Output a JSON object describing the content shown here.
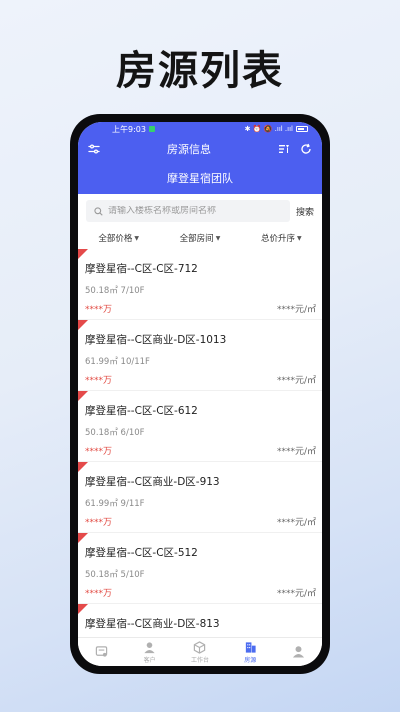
{
  "hero_title": "房源列表",
  "status_bar": {
    "time": "上午9:03",
    "icons_text": "✱ ⏰ 🔕 .ııl .ııl",
    "battery": ""
  },
  "header": {
    "title": "房源信息",
    "team_name": "摩登星宿团队"
  },
  "search": {
    "placeholder": "请输入楼栋名称或房间名称",
    "button_label": "搜索"
  },
  "filters": [
    {
      "label": "全部价格"
    },
    {
      "label": "全部房间"
    },
    {
      "label": "总价升序"
    }
  ],
  "listings": [
    {
      "title": "摩登星宿--C区-C区-712",
      "area": "50.18㎡",
      "floor": "7/10F",
      "price": "****万",
      "unit_price": "****元/㎡"
    },
    {
      "title": "摩登星宿--C区商业-D区-1013",
      "area": "61.99㎡",
      "floor": "10/11F",
      "price": "****万",
      "unit_price": "****元/㎡"
    },
    {
      "title": "摩登星宿--C区-C区-612",
      "area": "50.18㎡",
      "floor": "6/10F",
      "price": "****万",
      "unit_price": "****元/㎡"
    },
    {
      "title": "摩登星宿--C区商业-D区-913",
      "area": "61.99㎡",
      "floor": "9/11F",
      "price": "****万",
      "unit_price": "****元/㎡"
    },
    {
      "title": "摩登星宿--C区-C区-512",
      "area": "50.18㎡",
      "floor": "5/10F",
      "price": "****万",
      "unit_price": "****元/㎡"
    },
    {
      "title": "摩登星宿--C区商业-D区-813",
      "area": "",
      "floor": "",
      "price": "",
      "unit_price": ""
    }
  ],
  "tabbar": [
    {
      "label": "",
      "icon": "dashboard-icon"
    },
    {
      "label": "客户",
      "icon": "person-icon"
    },
    {
      "label": "工作台",
      "icon": "cube-icon"
    },
    {
      "label": "房源",
      "icon": "building-icon",
      "active": true
    },
    {
      "label": "",
      "icon": "profile-icon"
    }
  ],
  "colors": {
    "header_blue": "#4c5ff0",
    "price_red": "#e24b43",
    "active_tab": "#4c6cf0"
  }
}
